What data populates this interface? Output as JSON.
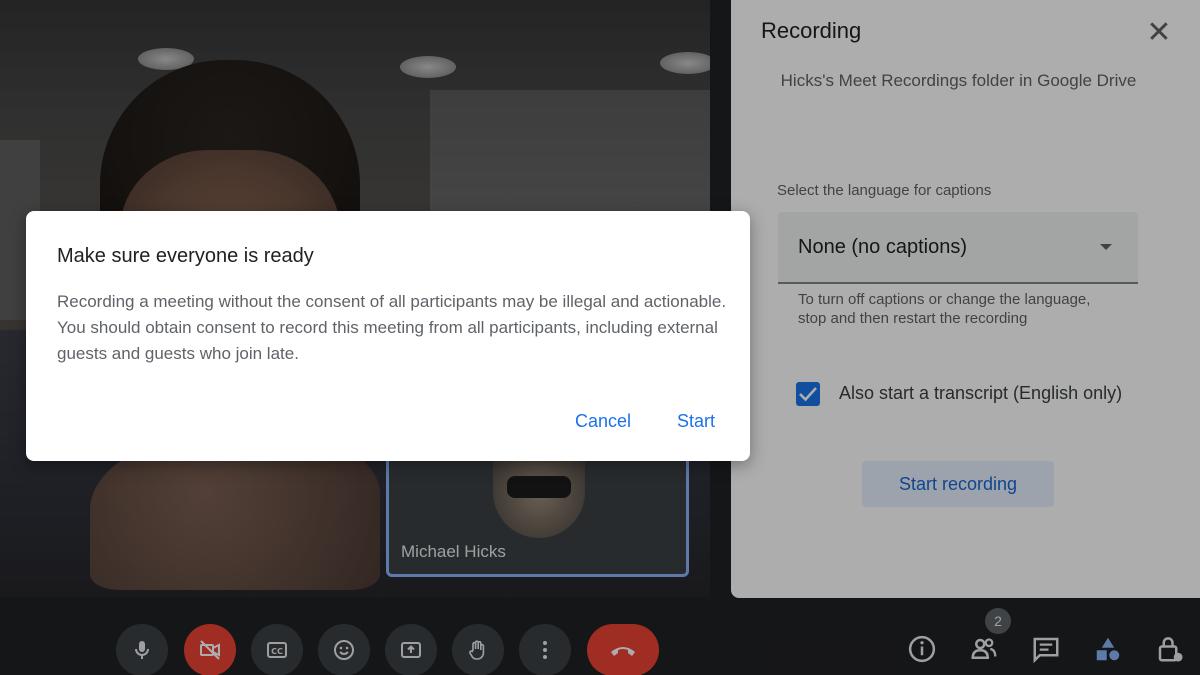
{
  "participant": {
    "name": "Michael Hicks"
  },
  "recording_panel": {
    "title": "Recording",
    "folder_note": "Hicks's Meet Recordings folder in Google Drive",
    "language_label": "Select the language for captions",
    "language_value": "None (no captions)",
    "language_helper": "To turn off captions or change the language, stop and then restart the recording",
    "transcript_label": "Also start a transcript (English only)",
    "transcript_checked": true,
    "start_button": "Start recording"
  },
  "dialog": {
    "title": "Make sure everyone is ready",
    "body": "Recording a meeting without the consent of all participants may be illegal and actionable. You should obtain consent to record this meeting from all participants, including external guests and guests who join late.",
    "cancel_label": "Cancel",
    "start_label": "Start"
  },
  "toolbar": {
    "people_count": "2",
    "icons": [
      "microphone-icon",
      "camera-off-icon",
      "captions-icon",
      "emoji-icon",
      "present-icon",
      "raise-hand-icon",
      "more-icon",
      "hang-up-icon",
      "info-icon",
      "people-icon",
      "chat-icon",
      "activities-icon",
      "host-controls-icon"
    ]
  },
  "colors": {
    "accent": "#1a73e8",
    "danger": "#ea4335",
    "bar": "#202124"
  }
}
